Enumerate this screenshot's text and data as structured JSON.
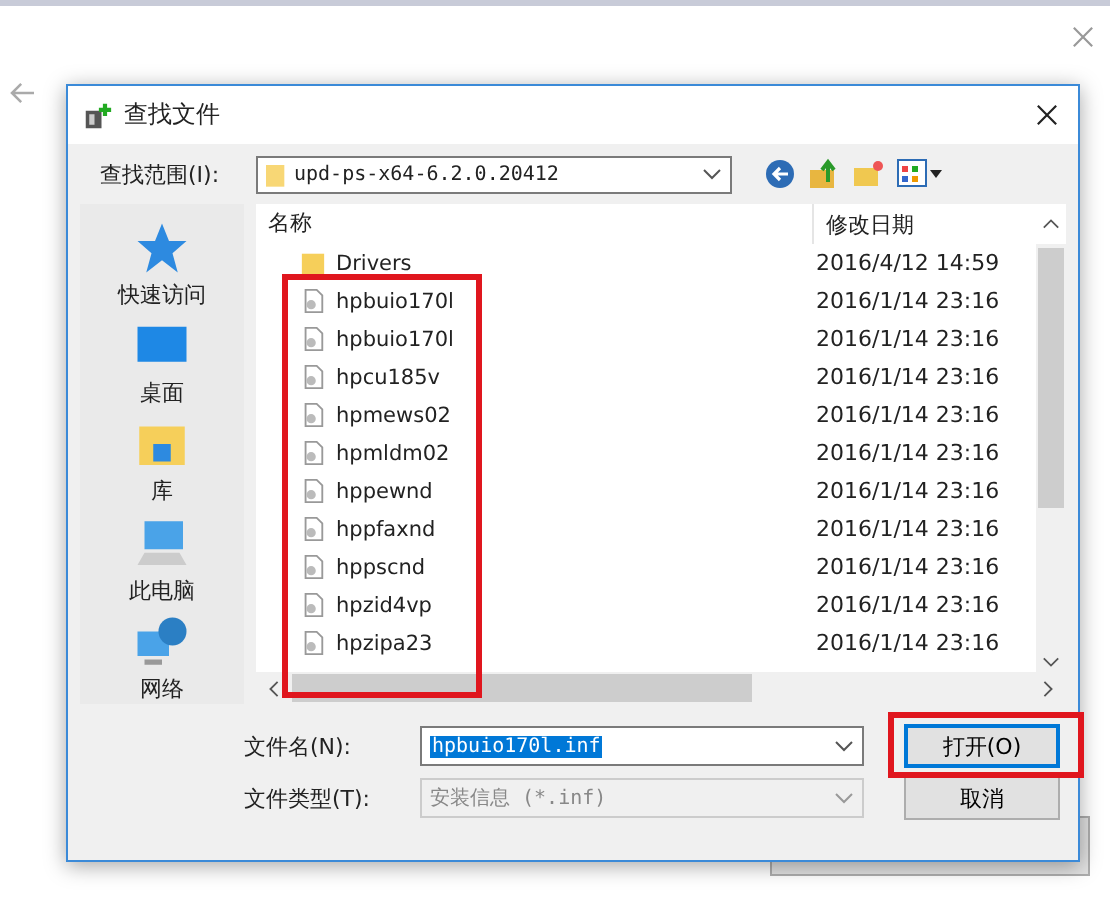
{
  "dialog": {
    "title": "查找文件",
    "look_in_label": "查找范围(I):",
    "look_in_value": "upd-ps-x64-6.2.0.20412"
  },
  "sidebar": [
    {
      "label": "快速访问",
      "kind": "star"
    },
    {
      "label": "桌面",
      "kind": "desktop"
    },
    {
      "label": "库",
      "kind": "library"
    },
    {
      "label": "此电脑",
      "kind": "computer"
    },
    {
      "label": "网络",
      "kind": "network"
    }
  ],
  "columns": [
    "名称",
    "修改日期"
  ],
  "rows": [
    {
      "name": "Drivers",
      "date": "2016/4/12 14:59",
      "kind": "folder"
    },
    {
      "name": "hpbuio170l",
      "date": "2016/1/14 23:16",
      "kind": "file"
    },
    {
      "name": "hpbuio170l",
      "date": "2016/1/14 23:16",
      "kind": "file"
    },
    {
      "name": "hpcu185v",
      "date": "2016/1/14 23:16",
      "kind": "file"
    },
    {
      "name": "hpmews02",
      "date": "2016/1/14 23:16",
      "kind": "file"
    },
    {
      "name": "hpmldm02",
      "date": "2016/1/14 23:16",
      "kind": "file"
    },
    {
      "name": "hppewnd",
      "date": "2016/1/14 23:16",
      "kind": "file"
    },
    {
      "name": "hppfaxnd",
      "date": "2016/1/14 23:16",
      "kind": "file"
    },
    {
      "name": "hppscnd",
      "date": "2016/1/14 23:16",
      "kind": "file"
    },
    {
      "name": "hpzid4vp",
      "date": "2016/1/14 23:16",
      "kind": "file"
    },
    {
      "name": "hpzipa23",
      "date": "2016/1/14 23:16",
      "kind": "file"
    }
  ],
  "file_name": {
    "label": "文件名(N):",
    "value": "hpbuio170l.inf"
  },
  "file_type": {
    "label": "文件类型(T):",
    "value": "安装信息 (*.inf)",
    "disabled": true
  },
  "buttons": [
    {
      "label": "打开(O)",
      "kind": "default"
    },
    {
      "label": "取消",
      "kind": "normal"
    }
  ]
}
